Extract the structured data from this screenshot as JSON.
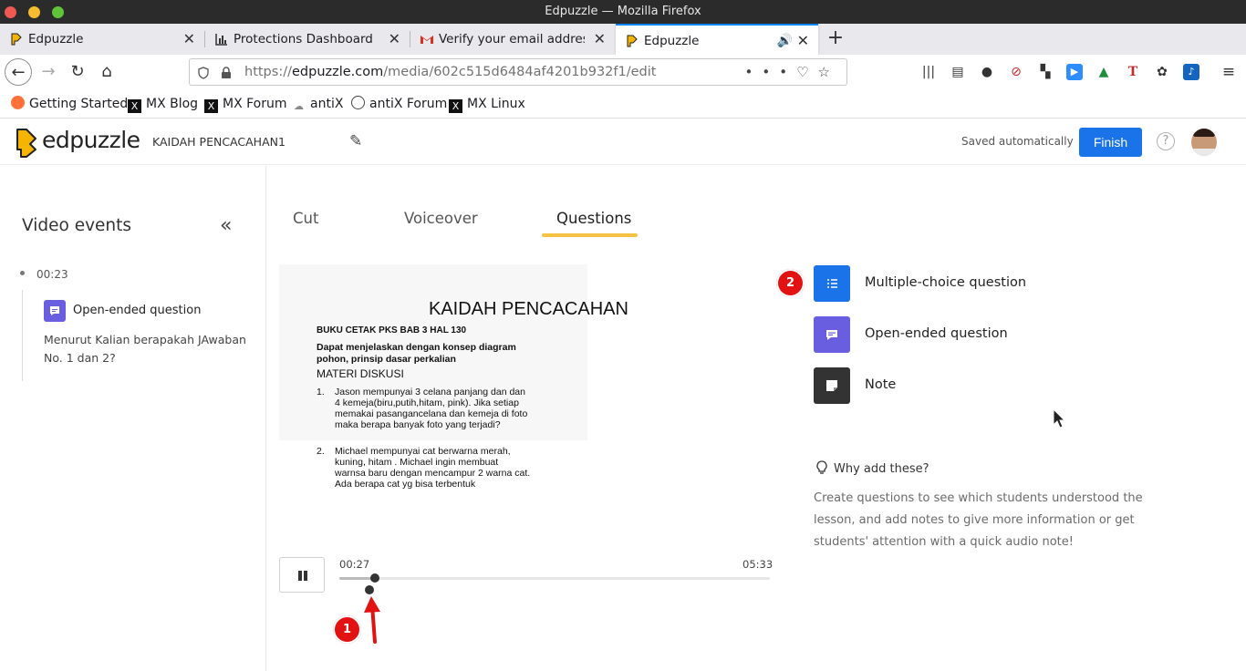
{
  "window": {
    "title": "Edpuzzle — Mozilla Firefox"
  },
  "tabs": [
    {
      "label": "Edpuzzle"
    },
    {
      "label": "Protections Dashboard"
    },
    {
      "label": "Verify your email address"
    },
    {
      "label": "Edpuzzle"
    }
  ],
  "url": {
    "prefix": "https://",
    "host": "edpuzzle.com",
    "path": "/media/602c515d6484af4201b932f1/edit"
  },
  "bookmarks": [
    {
      "label": "Getting Started"
    },
    {
      "label": "MX Blog"
    },
    {
      "label": "MX Forum"
    },
    {
      "label": "antiX"
    },
    {
      "label": "antiX Forum"
    },
    {
      "label": "MX Linux"
    }
  ],
  "header": {
    "logo_text": "edpuzzle",
    "lesson_title": "KAIDAH PENCACAHAN1",
    "saved_status": "Saved automatically",
    "finish_label": "Finish",
    "help_symbol": "?"
  },
  "sidebar": {
    "title": "Video events",
    "events": [
      {
        "time": "00:23",
        "type": "Open-ended question",
        "text": "Menurut Kalian berapakah JAwaban No. 1 dan 2?"
      }
    ]
  },
  "editor_tabs": [
    {
      "label": "Cut"
    },
    {
      "label": "Voiceover"
    },
    {
      "label": "Questions",
      "active": true
    }
  ],
  "slide": {
    "title": "KAIDAH PENCACAHAN",
    "subtitle": "BUKU CETAK PKS BAB 3 HAL 130",
    "goal": "Dapat menjelaskan dengan konsep diagram pohon, prinsip dasar perkalian",
    "heading": "MATERI DISKUSI",
    "items": [
      {
        "num": "1.",
        "text": "Jason mempunyai 3 celana panjang dan dan 4 kemeja(biru,putih,hitam, pink). Jika setiap memakai pasangancelana dan kemeja di foto maka berapa banyak foto yang terjadi?"
      },
      {
        "num": "2.",
        "text": "Michael mempunyai cat berwarna merah, kuning, hitam . Michael ingin membuat warnsa baru dengan mencampur 2 warna cat. Ada berapa cat yg bisa terbentuk"
      }
    ]
  },
  "player": {
    "current_time": "00:27",
    "total_time": "05:33",
    "progress": 0.081
  },
  "annotations": [
    {
      "number": "1"
    },
    {
      "number": "2"
    }
  ],
  "question_types": [
    {
      "label": "Multiple-choice question",
      "color": "#1a73e8",
      "icon": "list-icon"
    },
    {
      "label": "Open-ended question",
      "color": "#6a5ee0",
      "icon": "comment-icon"
    },
    {
      "label": "Note",
      "color": "#333333",
      "icon": "note-icon"
    }
  ],
  "why": {
    "title": "Why add these?",
    "text": "Create questions to see which students understood the lesson, and add notes to give more information or get students' attention with a quick audio note!"
  },
  "colors": {
    "accent": "#1a73e8",
    "tab_underline": "#f6c244",
    "annotation_red": "#e31212"
  }
}
